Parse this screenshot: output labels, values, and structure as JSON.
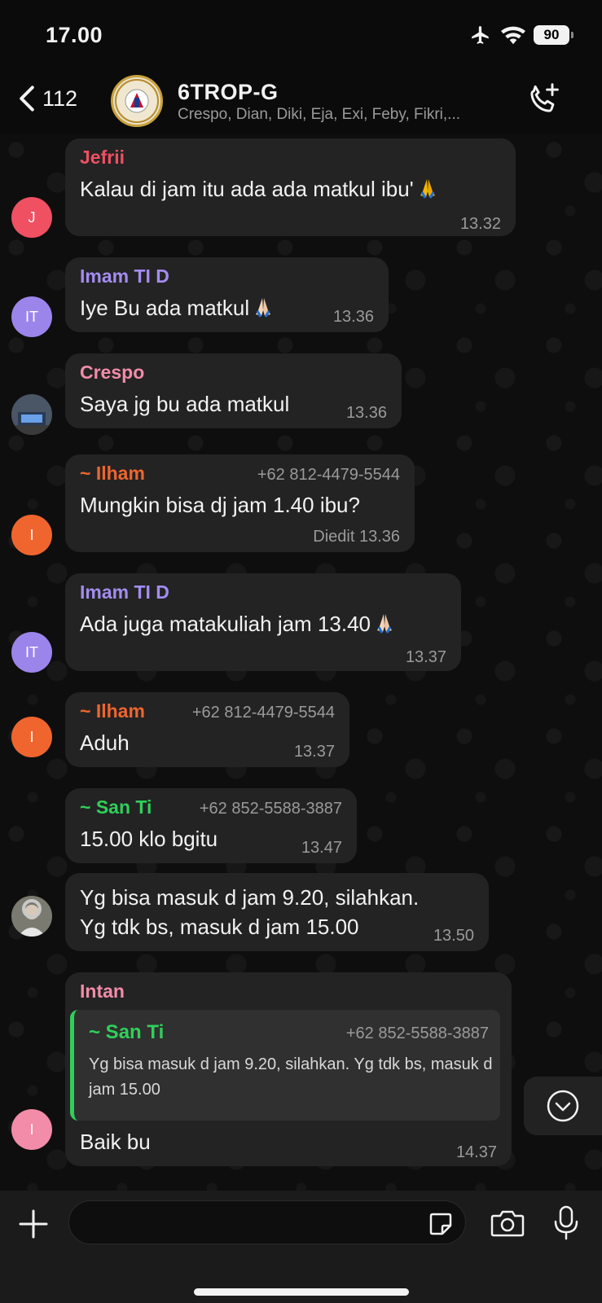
{
  "status_bar": {
    "time": "17.00",
    "battery": "90"
  },
  "header": {
    "back_count": "112",
    "title": "6TROP-G",
    "members": "Crespo, Dian, Diki, Eja, Exi, Feby, Fikri,..."
  },
  "messages": [
    {
      "sender": "Jefrii",
      "sender_color": "#ef5062",
      "text": "Kalau di jam itu ada ada matkul ibu'",
      "time": "13.32",
      "avatar": "J",
      "avatar_color": "#ef5062",
      "emoji": "folded-hands"
    },
    {
      "sender": "Imam TI D",
      "sender_color": "#a48cf0",
      "text": "Iye Bu ada matkul",
      "time": "13.36",
      "avatar": "IT",
      "avatar_color": "#9b84ea",
      "emoji": "folded-hands"
    },
    {
      "sender": "Crespo",
      "sender_color": "#f28ca8",
      "text": "Saya jg bu ada matkul",
      "time": "13.36",
      "avatar": "photo"
    },
    {
      "sender": "~ Ilham",
      "sender_color": "#f0652e",
      "phone": "+62 812-4479-5544",
      "text": "Mungkin bisa dj jam 1.40 ibu?",
      "time": "Diedit 13.36",
      "avatar": "I",
      "avatar_color": "#f0652e"
    },
    {
      "sender": "Imam TI D",
      "sender_color": "#a48cf0",
      "text": "Ada juga matakuliah jam 13.40",
      "time": "13.37",
      "avatar": "IT",
      "avatar_color": "#9b84ea",
      "emoji": "folded-hands"
    },
    {
      "sender": "~ Ilham",
      "sender_color": "#f0652e",
      "phone": "+62 812-4479-5544",
      "text": "Aduh",
      "time": "13.37",
      "avatar": "I",
      "avatar_color": "#f0652e"
    },
    {
      "sender": "~ San Ti",
      "sender_color": "#2fd05a",
      "phone": "+62 852-5588-3887",
      "text": "15.00 klo bgitu",
      "time": "13.47"
    },
    {
      "text_line1": "Yg bisa masuk d jam 9.20, silahkan.",
      "text_line2": "Yg tdk bs, masuk d jam 15.00",
      "time": "13.50",
      "avatar": "photo"
    },
    {
      "sender": "Intan",
      "sender_color": "#f28ca8",
      "quote": {
        "sender": "~ San Ti",
        "phone": "+62 852-5588-3887",
        "text": "Yg bisa masuk d jam 9.20, silahkan. Yg tdk bs, masuk d jam 15.00"
      },
      "text": "Baik bu",
      "time": "14.37",
      "avatar": "I",
      "avatar_color": "#f28ca8"
    }
  ],
  "input": {
    "placeholder": ""
  }
}
